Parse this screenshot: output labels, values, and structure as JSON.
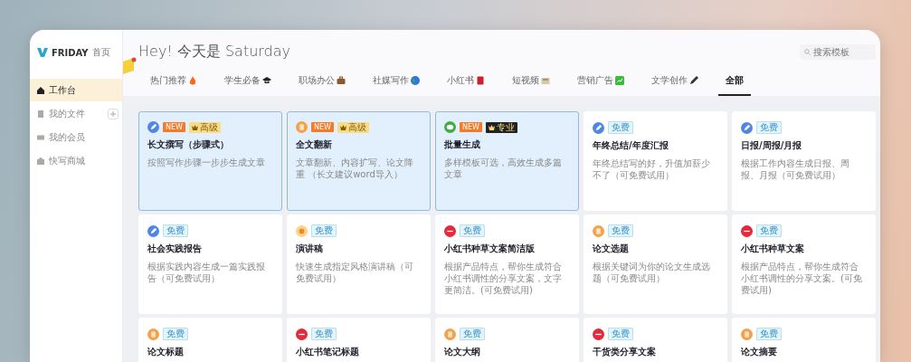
{
  "sidebar": {
    "brand": "FRIDAY",
    "home_link": "首页",
    "items": [
      {
        "label": "工作台",
        "selected": true,
        "has_add": false
      },
      {
        "label": "我的文件",
        "selected": false,
        "has_add": true
      },
      {
        "label": "我的会员",
        "selected": false,
        "has_add": false
      },
      {
        "label": "快写商城",
        "selected": false,
        "has_add": false
      }
    ]
  },
  "header": {
    "greeting": "Hey! 今天是 Saturday",
    "search": {
      "placeholder": "搜索模板"
    }
  },
  "tabs": [
    {
      "label": "热门推荐",
      "selected": false
    },
    {
      "label": "学生必备",
      "selected": false
    },
    {
      "label": "职场办公",
      "selected": false
    },
    {
      "label": "社媒写作",
      "selected": false
    },
    {
      "label": "小红书",
      "selected": false
    },
    {
      "label": "短视频",
      "selected": false
    },
    {
      "label": "营销广告",
      "selected": false
    },
    {
      "label": "文学创作",
      "selected": false
    },
    {
      "label": "全部",
      "selected": true
    }
  ],
  "cards": [
    {
      "kind": "pen",
      "badges": [
        {
          "kind": "new",
          "text": "NEW"
        },
        {
          "kind": "premium",
          "text": "高级"
        }
      ],
      "title": "长文撰写（步骤式）",
      "desc": "按照写作步骤一步步生成文章",
      "highlighted": true
    },
    {
      "kind": "doc",
      "badges": [
        {
          "kind": "new",
          "text": "NEW"
        },
        {
          "kind": "premium",
          "text": "高级"
        }
      ],
      "title": "全文翻新",
      "desc": "文章翻新、内容扩写、论文降重 （长文建议word导入）",
      "highlighted": true
    },
    {
      "kind": "chat",
      "badges": [
        {
          "kind": "new",
          "text": "NEW"
        },
        {
          "kind": "pro",
          "text": "专业"
        }
      ],
      "title": "批量生成",
      "desc": "多样模板可选，高效生成多篇文章",
      "highlighted": true
    },
    {
      "kind": "pen",
      "badges": [
        {
          "kind": "free",
          "text": "免费"
        }
      ],
      "title": "年终总结/年度汇报",
      "desc": "年终总结写的好，升值加薪少不了（可免费试用）",
      "highlighted": false
    },
    {
      "kind": "pen",
      "badges": [
        {
          "kind": "free",
          "text": "免费"
        }
      ],
      "title": "日报/周报/月报",
      "desc": "根据工作内容生成日报、周报、月报（可免费试用）",
      "highlighted": false
    },
    {
      "kind": "pen",
      "badges": [
        {
          "kind": "free",
          "text": "免费"
        }
      ],
      "title": "社会实践报告",
      "desc": "根据实践内容生成一篇实践报告（可免费试用）",
      "highlighted": false
    },
    {
      "kind": "speech",
      "badges": [
        {
          "kind": "free",
          "text": "免费"
        }
      ],
      "title": "演讲稿",
      "desc": "快速生成指定风格演讲稿（可免费试用）",
      "highlighted": false
    },
    {
      "kind": "social",
      "badges": [
        {
          "kind": "free",
          "text": "免费"
        }
      ],
      "title": "小红书种草文案简洁版",
      "desc": "根据产品特点，帮你生成符合小红书调性的分享文案，文字更简洁。(可免费试用)",
      "highlighted": false
    },
    {
      "kind": "doc",
      "badges": [
        {
          "kind": "free",
          "text": "免费"
        }
      ],
      "title": "论文选题",
      "desc": "根据关键词为你的论文生成选题（可免费试用）",
      "highlighted": false
    },
    {
      "kind": "social",
      "badges": [
        {
          "kind": "free",
          "text": "免费"
        }
      ],
      "title": "小红书种草文案",
      "desc": "根据产品特点，帮你生成符合小红书调性的分享文案。(可免费试用)",
      "highlighted": false
    },
    {
      "kind": "doc",
      "badges": [
        {
          "kind": "free",
          "text": "免费"
        }
      ],
      "title": "论文标题",
      "highlighted": false
    },
    {
      "kind": "social",
      "badges": [
        {
          "kind": "free",
          "text": "免费"
        }
      ],
      "title": "小红书笔记标题",
      "highlighted": false
    },
    {
      "kind": "doc",
      "badges": [
        {
          "kind": "free",
          "text": "免费"
        }
      ],
      "title": "论文大纲",
      "highlighted": false
    },
    {
      "kind": "social",
      "badges": [
        {
          "kind": "free",
          "text": "免费"
        }
      ],
      "title": "干货类分享文案",
      "highlighted": false
    },
    {
      "kind": "doc",
      "badges": [
        {
          "kind": "free",
          "text": "免费"
        }
      ],
      "title": "论文摘要",
      "highlighted": false
    }
  ]
}
